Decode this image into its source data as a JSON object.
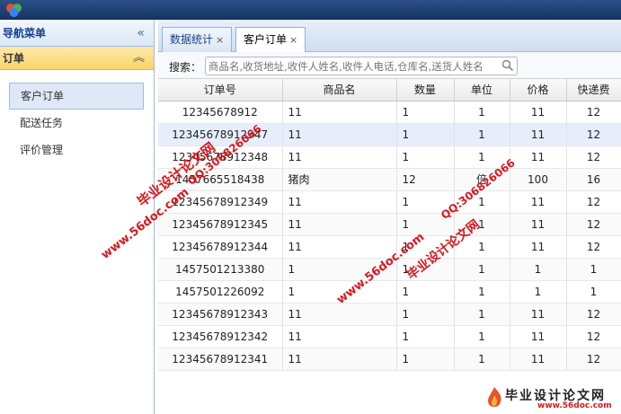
{
  "sidebar": {
    "title": "导航菜单",
    "collapse_icon": "«",
    "section": "订单",
    "section_icon": "︽",
    "items": [
      {
        "label": "客户订单",
        "active": true
      },
      {
        "label": "配送任务",
        "active": false
      },
      {
        "label": "评价管理",
        "active": false
      }
    ]
  },
  "tabs": [
    {
      "label": "数据统计",
      "close": "×"
    },
    {
      "label": "客户订单",
      "close": "×"
    }
  ],
  "search": {
    "label": "搜索：",
    "placeholder": "商品名,收货地址,收件人姓名,收件人电话,仓库名,送货人姓名"
  },
  "table": {
    "columns": [
      "订单号",
      "商品名",
      "数量",
      "单位",
      "价格",
      "快递费"
    ],
    "rows": [
      [
        "12345678912",
        "11",
        "1",
        "1",
        "11",
        "12"
      ],
      [
        "12345678912347",
        "11",
        "1",
        "1",
        "11",
        "12"
      ],
      [
        "12345678912348",
        "11",
        "1",
        "1",
        "11",
        "12"
      ],
      [
        "1457665518438",
        "猪肉",
        "12",
        "倍",
        "100",
        "16"
      ],
      [
        "12345678912349",
        "11",
        "1",
        "1",
        "11",
        "12"
      ],
      [
        "12345678912345",
        "11",
        "1",
        "1",
        "11",
        "12"
      ],
      [
        "12345678912344",
        "11",
        "1",
        "1",
        "11",
        "12"
      ],
      [
        "1457501213380",
        "1",
        "1",
        "1",
        "1",
        "1"
      ],
      [
        "1457501226092",
        "1",
        "1",
        "1",
        "1",
        "1"
      ],
      [
        "12345678912343",
        "11",
        "1",
        "1",
        "11",
        "12"
      ],
      [
        "12345678912342",
        "11",
        "1",
        "1",
        "11",
        "12"
      ],
      [
        "12345678912341",
        "11",
        "1",
        "1",
        "11",
        "12"
      ]
    ]
  },
  "watermarks": {
    "site": "www.56doc.com",
    "qq": "QQ:306826066",
    "name": "毕业设计论文网"
  },
  "brand": {
    "name": "毕业设计论文网",
    "url": "www.56doc.com"
  },
  "colors": {
    "topbar": "#163462",
    "accent": "#99bbe8",
    "watermark": "#d8181f"
  }
}
